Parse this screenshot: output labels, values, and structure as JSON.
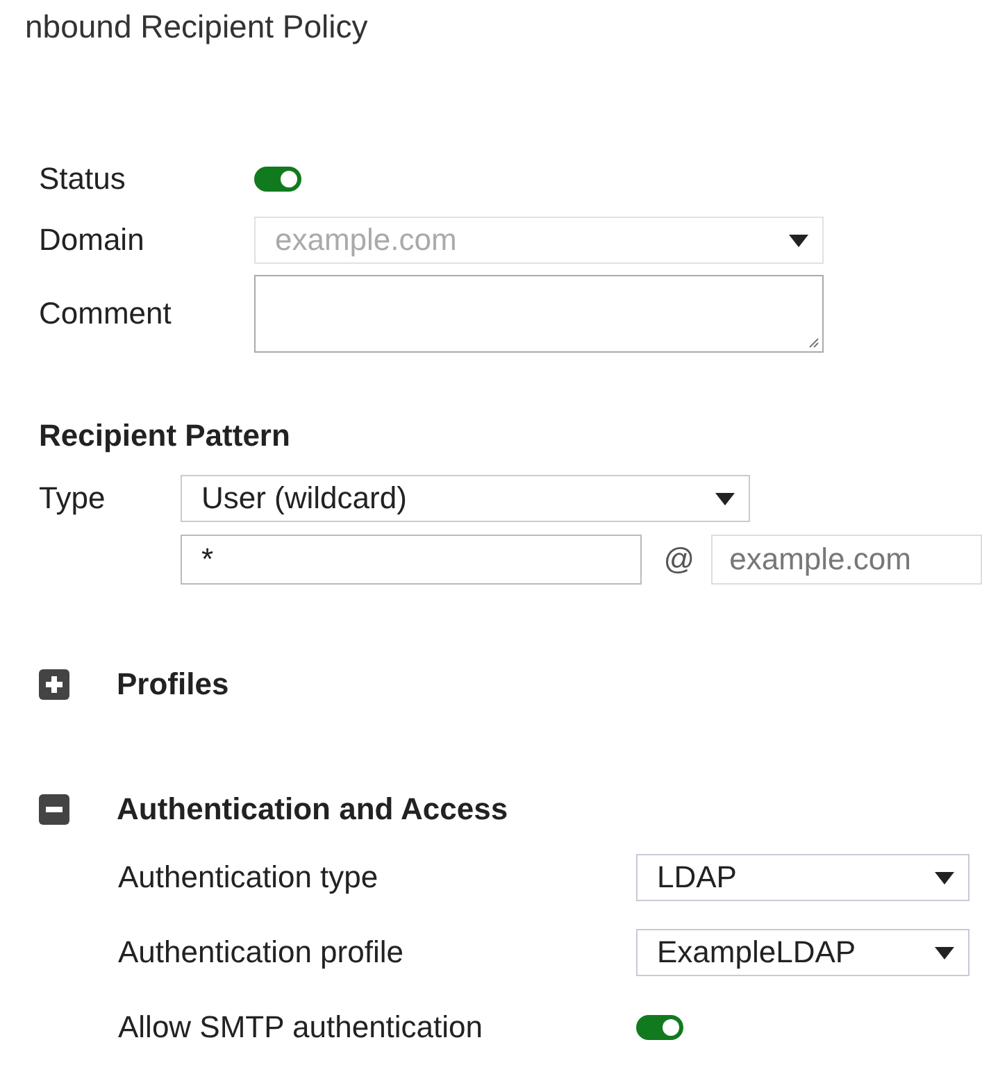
{
  "title": "nbound Recipient Policy",
  "general": {
    "status": {
      "label": "Status",
      "on": true
    },
    "domain": {
      "label": "Domain",
      "value": "example.com",
      "disabled": true
    },
    "comment": {
      "label": "Comment"
    }
  },
  "recipient_pattern": {
    "heading": "Recipient Pattern",
    "type": {
      "label": "Type",
      "value": "User (wildcard)"
    },
    "local_part": "*",
    "at": "@",
    "domain": "example.com"
  },
  "sections": [
    {
      "title": "Profiles",
      "expanded": false
    },
    {
      "title": "Authentication and Access",
      "expanded": true,
      "rows": [
        {
          "kind": "select",
          "label": "Authentication type",
          "value": "LDAP"
        },
        {
          "kind": "select",
          "label": "Authentication profile",
          "value": "ExampleLDAP"
        },
        {
          "kind": "toggle",
          "label": "Allow SMTP authentication",
          "on": true
        }
      ]
    }
  ]
}
